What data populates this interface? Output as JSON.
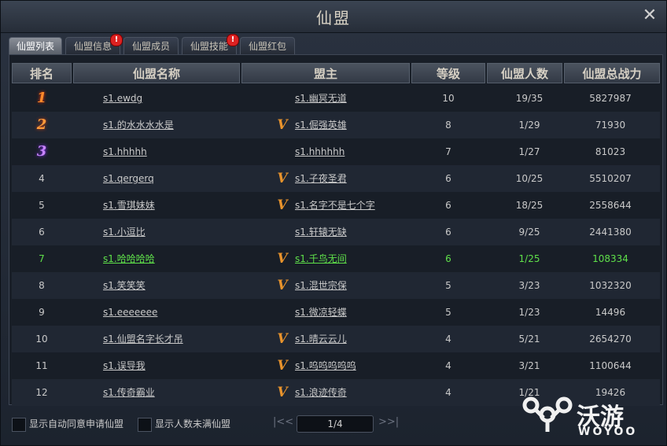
{
  "window": {
    "title": "仙盟"
  },
  "tabs": [
    {
      "label": "仙盟列表",
      "active": true,
      "badge": ""
    },
    {
      "label": "仙盟信息",
      "active": false,
      "badge": "!"
    },
    {
      "label": "仙盟成员",
      "active": false,
      "badge": ""
    },
    {
      "label": "仙盟技能",
      "active": false,
      "badge": "!"
    },
    {
      "label": "仙盟红包",
      "active": false,
      "badge": ""
    }
  ],
  "table": {
    "headers": {
      "rank": "排名",
      "name": "仙盟名称",
      "leader": "盟主",
      "level": "等级",
      "members": "仙盟人数",
      "power": "仙盟总战力"
    },
    "rows": [
      {
        "rank": "1",
        "name": "s1.ewdg",
        "vip": "",
        "leader": "s1.幽冥无道",
        "level": "10",
        "members": "19/35",
        "power": "5827987"
      },
      {
        "rank": "2",
        "name": "s1.的水水水水是",
        "vip": "V",
        "leader": "s1.倔强英雄",
        "level": "8",
        "members": "1/29",
        "power": "71930"
      },
      {
        "rank": "3",
        "name": "s1.hhhhh",
        "vip": "",
        "leader": "s1.hhhhhh",
        "level": "7",
        "members": "1/27",
        "power": "81023"
      },
      {
        "rank": "4",
        "name": "s1.qergerq",
        "vip": "V",
        "leader": "s1.子夜圣君",
        "level": "6",
        "members": "10/25",
        "power": "5510207"
      },
      {
        "rank": "5",
        "name": "s1.雪琪妹妹",
        "vip": "V",
        "leader": "s1.名字不是七个字",
        "level": "6",
        "members": "18/25",
        "power": "2558644"
      },
      {
        "rank": "6",
        "name": "s1.小逗比",
        "vip": "",
        "leader": "s1.轩辕无缺",
        "level": "6",
        "members": "9/25",
        "power": "2441380"
      },
      {
        "rank": "7",
        "name": "s1.哈哈哈哈",
        "vip": "V",
        "leader": "s1.千鸟无间",
        "level": "6",
        "members": "1/25",
        "power": "108334",
        "self": true
      },
      {
        "rank": "8",
        "name": "s1.笑笑笑",
        "vip": "V",
        "leader": "s1.混世宗保",
        "level": "5",
        "members": "3/23",
        "power": "1032320"
      },
      {
        "rank": "9",
        "name": "s1.eeeeeee",
        "vip": "",
        "leader": "s1.微凉轻蝶",
        "level": "5",
        "members": "1/23",
        "power": "14496"
      },
      {
        "rank": "10",
        "name": "s1.仙盟名字长才吊",
        "vip": "V",
        "leader": "s1.晴云云儿",
        "level": "4",
        "members": "5/21",
        "power": "2654270"
      },
      {
        "rank": "11",
        "name": "s1.误导我",
        "vip": "V",
        "leader": "s1.呜呜呜呜呜",
        "level": "4",
        "members": "3/21",
        "power": "1100644"
      },
      {
        "rank": "12",
        "name": "s1.传奇霸业",
        "vip": "V",
        "leader": "s1.浪迹传奇",
        "level": "4",
        "members": "1/21",
        "power": "19426"
      }
    ]
  },
  "footer": {
    "auto_accept_label": "显示自动同意申请仙盟",
    "not_full_label": "显示人数未满仙盟",
    "page": "1/4",
    "first_icon": "|<<",
    "last_icon": ">>|"
  },
  "watermark": {
    "text": "沃游",
    "sub": "WOYOO"
  },
  "colors": {
    "self_row": "#5fe04a",
    "vip": "#e8932c",
    "badge": "#dd2222"
  }
}
